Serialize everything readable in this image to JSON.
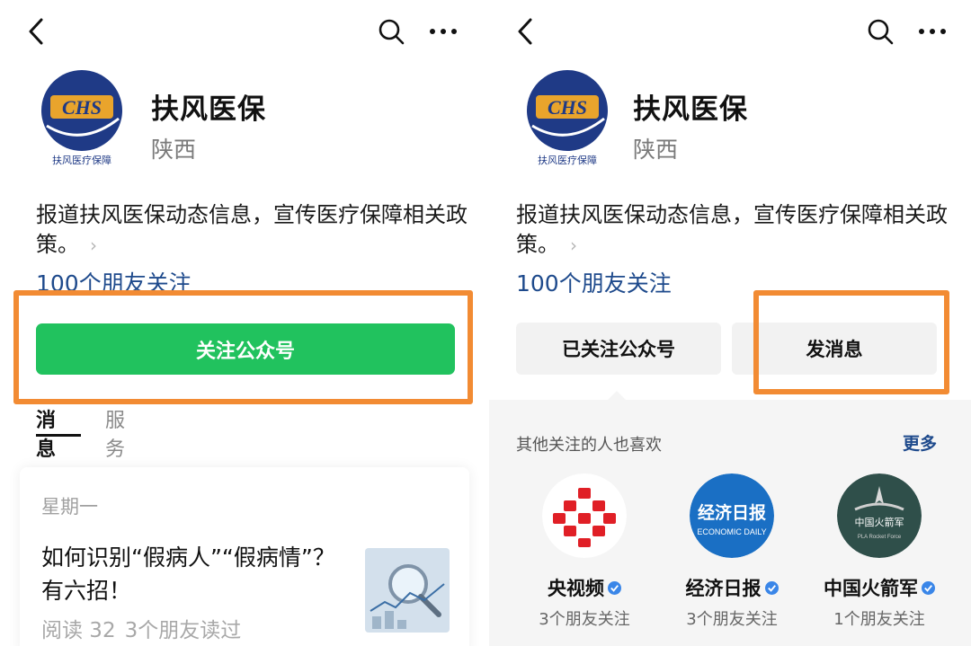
{
  "left": {
    "account": {
      "name": "扶风医保",
      "region": "陕西",
      "logo_text": "CHS",
      "logo_caption": "扶风医疗保障"
    },
    "description": "报道扶风医保动态信息，宣传医疗保障相关政策。",
    "friends_following": "100个朋友关注",
    "follow_button": "关注公众号",
    "tabs": {
      "messages": "消息",
      "services": "服务"
    },
    "article": {
      "weekday": "星期一",
      "title": "如何识别“假病人”“假病情”？有六招！",
      "reads": "阅读 32",
      "friends_read": "3个朋友读过"
    }
  },
  "right": {
    "account": {
      "name": "扶风医保",
      "region": "陕西",
      "logo_text": "CHS",
      "logo_caption": "扶风医疗保障"
    },
    "description": "报道扶风医保动态信息，宣传医疗保障相关政策。",
    "friends_following": "100个朋友关注",
    "followed_button": "已关注公众号",
    "message_button": "发消息",
    "recommendations": {
      "title": "其他关注的人也喜欢",
      "more": "更多",
      "items": [
        {
          "name": "央视频",
          "count": "3个朋友关注"
        },
        {
          "name": "经济日报",
          "count": "3个朋友关注",
          "logo_text": "经济日报",
          "logo_sub": "ECONOMIC DAILY"
        },
        {
          "name": "中国火箭军",
          "count": "1个朋友关注",
          "logo_text": "中国火箭军",
          "logo_sub": "PLA Rocket Force"
        }
      ]
    }
  },
  "colors": {
    "green": "#21c25e",
    "orange": "#f28b33",
    "link": "#1e4a8c",
    "verified": "#3a86e8"
  },
  "icons": [
    "back-icon",
    "search-icon",
    "more-icon",
    "chevron-right-icon",
    "verified-icon"
  ]
}
